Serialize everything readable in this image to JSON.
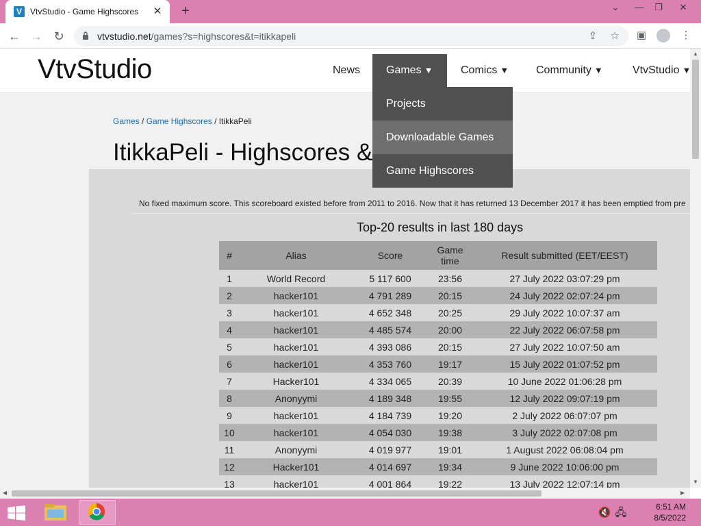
{
  "browser": {
    "tab_title": "VtvStudio - Game Highscores",
    "favicon_letter": "V",
    "url_host": "vtvstudio.net",
    "url_path": "/games?s=highscores&t=itikkapeli"
  },
  "site": {
    "logo": "VtvStudio",
    "nav": {
      "news": "News",
      "games": "Games",
      "comics": "Comics",
      "community": "Community",
      "vtvstudio": "VtvStudio"
    },
    "dropdown": [
      "Projects",
      "Downloadable Games",
      "Game Highscores"
    ]
  },
  "breadcrumb": {
    "games": "Games",
    "sep1": " / ",
    "highscores": "Game Highscores",
    "sep2": " / ",
    "current": "ItikkaPeli"
  },
  "page": {
    "title": "ItikkaPeli - Highscores &",
    "notice": "No fixed maximum score. This scoreboard existed before from 2011 to 2016. Now that it has returned 13 December 2017 it has been emptied from pre",
    "subheading": "Top-20 results in last 180 days"
  },
  "table": {
    "headers": {
      "rank": "#",
      "alias": "Alias",
      "score": "Score",
      "time_line1": "Game",
      "time_line2": "time",
      "date": "Result submitted (EET/EEST)"
    },
    "rows": [
      {
        "rank": "1",
        "alias": "World Record",
        "score": "5 117 600",
        "time": "23:56",
        "date": "27 July 2022 03:07:29 pm"
      },
      {
        "rank": "2",
        "alias": "hacker101",
        "score": "4 791 289",
        "time": "20:15",
        "date": "24 July 2022 02:07:24 pm"
      },
      {
        "rank": "3",
        "alias": "hacker101",
        "score": "4 652 348",
        "time": "20:25",
        "date": "29 July 2022 10:07:37 am"
      },
      {
        "rank": "4",
        "alias": "hacker101",
        "score": "4 485 574",
        "time": "20:00",
        "date": "22 July 2022 06:07:58 pm"
      },
      {
        "rank": "5",
        "alias": "hacker101",
        "score": "4 393 086",
        "time": "20:15",
        "date": "27 July 2022 10:07:50 am"
      },
      {
        "rank": "6",
        "alias": "hacker101",
        "score": "4 353 760",
        "time": "19:17",
        "date": "15 July 2022 01:07:52 pm"
      },
      {
        "rank": "7",
        "alias": "Hacker101",
        "score": "4 334 065",
        "time": "20:39",
        "date": "10 June 2022 01:06:28 pm"
      },
      {
        "rank": "8",
        "alias": "Anonyymi",
        "score": "4 189 348",
        "time": "19:55",
        "date": "12 July 2022 09:07:19 pm"
      },
      {
        "rank": "9",
        "alias": "hacker101",
        "score": "4 184 739",
        "time": "19:20",
        "date": "2 July 2022 06:07:07 pm"
      },
      {
        "rank": "10",
        "alias": "hacker101",
        "score": "4 054 030",
        "time": "19:38",
        "date": "3 July 2022 02:07:08 pm"
      },
      {
        "rank": "11",
        "alias": "Anonyymi",
        "score": "4 019 977",
        "time": "19:01",
        "date": "1 August 2022 06:08:04 pm"
      },
      {
        "rank": "12",
        "alias": "Hacker101",
        "score": "4 014 697",
        "time": "19:34",
        "date": "9 June 2022 10:06:00 pm"
      },
      {
        "rank": "13",
        "alias": "hacker101",
        "score": "4 001 864",
        "time": "19:22",
        "date": "13 July 2022 12:07:14 pm"
      }
    ]
  },
  "taskbar": {
    "time": "6:51 AM",
    "date": "8/5/2022"
  },
  "colors": {
    "titlebar": "#dc7fb1",
    "nav_active": "#505050",
    "link": "#1a6fb5"
  }
}
